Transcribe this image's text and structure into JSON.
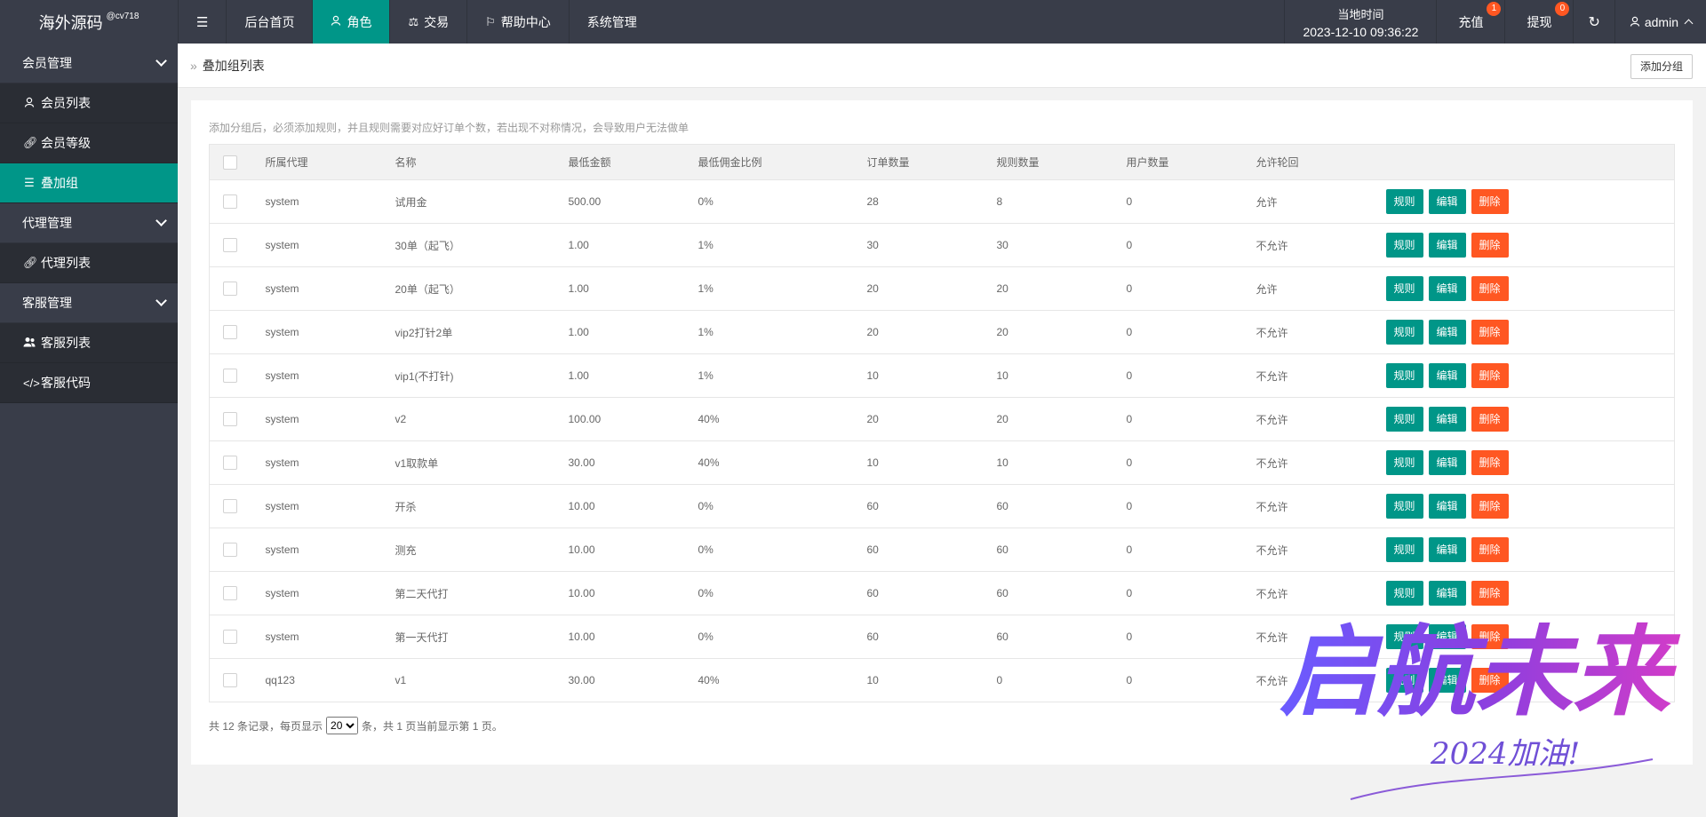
{
  "header": {
    "logo": "海外源码",
    "logo_sup": "@cv718",
    "nav": [
      {
        "label": "后台首页",
        "icon": "none"
      },
      {
        "label": "角色",
        "icon": "user-icon",
        "active": true
      },
      {
        "label": "交易",
        "icon": "scale-icon"
      },
      {
        "label": "帮助中心",
        "icon": "flag-icon"
      },
      {
        "label": "系统管理",
        "icon": "none"
      }
    ],
    "time_label": "当地时间",
    "time_value": "2023-12-10 09:36:22",
    "recharge": {
      "label": "充值",
      "badge": "1"
    },
    "withdraw": {
      "label": "提现",
      "badge": "0"
    },
    "user": "admin"
  },
  "sidebar": {
    "groups": [
      {
        "label": "会员管理",
        "items": [
          {
            "label": "会员列表",
            "icon": "user-icon"
          },
          {
            "label": "会员等级",
            "icon": "link-icon"
          },
          {
            "label": "叠加组",
            "icon": "list-icon",
            "active": true
          }
        ]
      },
      {
        "label": "代理管理",
        "items": [
          {
            "label": "代理列表",
            "icon": "link-icon"
          }
        ]
      },
      {
        "label": "客服管理",
        "items": [
          {
            "label": "客服列表",
            "icon": "users-icon"
          },
          {
            "label": "客服代码",
            "icon": "code-icon"
          }
        ]
      }
    ]
  },
  "page": {
    "breadcrumb": "叠加组列表",
    "add_button": "添加分组",
    "notice": "添加分组后，必须添加规则，并且规则需要对应好订单个数，若出现不对称情况，会导致用户无法做单"
  },
  "table": {
    "columns": [
      "所属代理",
      "名称",
      "最低金额",
      "最低佣金比例",
      "订单数量",
      "规则数量",
      "用户数量",
      "允许轮回"
    ],
    "actions": {
      "rule": "规则",
      "edit": "编辑",
      "delete": "删除"
    },
    "rows": [
      [
        "system",
        "试用金",
        "500.00",
        "0%",
        "28",
        "8",
        "0",
        "允许"
      ],
      [
        "system",
        "30单（起飞）",
        "1.00",
        "1%",
        "30",
        "30",
        "0",
        "不允许"
      ],
      [
        "system",
        "20单（起飞）",
        "1.00",
        "1%",
        "20",
        "20",
        "0",
        "允许"
      ],
      [
        "system",
        "vip2打针2单",
        "1.00",
        "1%",
        "20",
        "20",
        "0",
        "不允许"
      ],
      [
        "system",
        "vip1(不打针)",
        "1.00",
        "1%",
        "10",
        "10",
        "0",
        "不允许"
      ],
      [
        "system",
        "v2",
        "100.00",
        "40%",
        "20",
        "20",
        "0",
        "不允许"
      ],
      [
        "system",
        "v1取款单",
        "30.00",
        "40%",
        "10",
        "10",
        "0",
        "不允许"
      ],
      [
        "system",
        "开杀",
        "10.00",
        "0%",
        "60",
        "60",
        "0",
        "不允许"
      ],
      [
        "system",
        "测充",
        "10.00",
        "0%",
        "60",
        "60",
        "0",
        "不允许"
      ],
      [
        "system",
        "第二天代打",
        "10.00",
        "0%",
        "60",
        "60",
        "0",
        "不允许"
      ],
      [
        "system",
        "第一天代打",
        "10.00",
        "0%",
        "60",
        "60",
        "0",
        "不允许"
      ],
      [
        "qq123",
        "v1",
        "30.00",
        "40%",
        "10",
        "0",
        "0",
        "不允许"
      ]
    ]
  },
  "pager": {
    "prefix": "共 12 条记录，每页显示",
    "page_size": "20",
    "suffix": "条，共 1 页当前显示第 1 页。"
  },
  "watermark": {
    "main": "启航未来",
    "sub": "2024加油!"
  },
  "colors": {
    "accent": "#009688",
    "danger": "#ff5722",
    "dark": "#393d49"
  }
}
